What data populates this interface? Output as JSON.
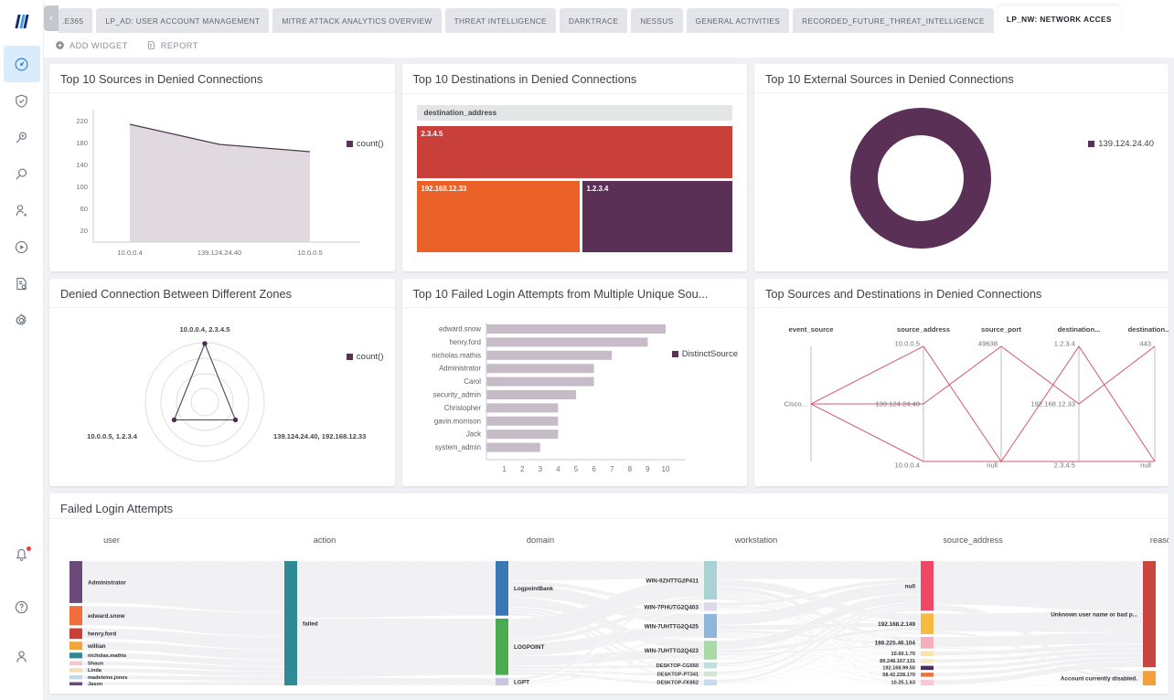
{
  "app": {
    "logo_name": "logpoint-logo"
  },
  "tabs": {
    "scroll_left_label": "‹",
    "items": [
      {
        "label": ".E365",
        "active": false,
        "clipped": true
      },
      {
        "label": "LP_AD: USER ACCOUNT MANAGEMENT",
        "active": false
      },
      {
        "label": "MITRE ATTACK ANALYTICS OVERVIEW",
        "active": false
      },
      {
        "label": "THREAT INTELLIGENCE",
        "active": false
      },
      {
        "label": "DARKTRACE",
        "active": false
      },
      {
        "label": "NESSUS",
        "active": false
      },
      {
        "label": "GENERAL ACTIVITIES",
        "active": false
      },
      {
        "label": "RECORDED_FUTURE_THREAT_INTELLIGENCE",
        "active": false
      },
      {
        "label": "LP_NW: NETWORK ACCES",
        "active": true
      }
    ]
  },
  "toolbar": {
    "add_widget_label": "ADD WIDGET",
    "report_label": "REPORT"
  },
  "sidebar": {
    "items": [
      {
        "name": "dashboard",
        "icon": "dashboard-icon",
        "active": true
      },
      {
        "name": "shield",
        "icon": "shield-check-icon",
        "active": false
      },
      {
        "name": "search-plus",
        "icon": "search-plus-icon",
        "active": false
      },
      {
        "name": "search",
        "icon": "search-icon",
        "active": false
      },
      {
        "name": "user-add",
        "icon": "user-add-icon",
        "active": false
      },
      {
        "name": "playbook",
        "icon": "play-circle-icon",
        "active": false
      },
      {
        "name": "report",
        "icon": "report-icon",
        "active": false
      },
      {
        "name": "settings",
        "icon": "gear-icon",
        "active": false
      }
    ],
    "bottom_items": [
      {
        "name": "notifications",
        "icon": "bell-icon",
        "badge": true
      },
      {
        "name": "help",
        "icon": "help-circle-icon",
        "badge": false
      },
      {
        "name": "profile",
        "icon": "user-icon",
        "badge": false
      }
    ]
  },
  "colors": {
    "accent_purple": "#5b3057",
    "area_fill": "#ded7de",
    "treemap_red": "#c9403a",
    "treemap_orange": "#ea6227",
    "treemap_purple": "#5b3057",
    "parallel_line": "#d4586e",
    "sankey_link": "#f2f2f3"
  },
  "widgets": [
    {
      "id": "w1",
      "title": "Top 10 Sources in Denied Connections"
    },
    {
      "id": "w2",
      "title": "Top 10 Destinations in Denied Connections"
    },
    {
      "id": "w3",
      "title": "Top 10 External Sources in Denied Connections"
    },
    {
      "id": "w4",
      "title": "Denied Connection Between Different Zones"
    },
    {
      "id": "w5",
      "title": "Top 10 Failed Login Attempts from Multiple Unique Sou..."
    },
    {
      "id": "w6",
      "title": "Top Sources and Destinations in Denied Connections"
    },
    {
      "id": "w7",
      "title": "Failed Login Attempts"
    }
  ],
  "chart_data": [
    {
      "type": "area",
      "widget": "w1",
      "title": "Top 10 Sources in Denied Connections",
      "categories": [
        "10.0.0.4",
        "139.124.24.40",
        "10.0.0.5"
      ],
      "values": [
        216,
        179,
        166
      ],
      "legend": [
        "count()"
      ],
      "legend_position": "top-right",
      "xlabel": "",
      "ylabel": "",
      "ylim": [
        0,
        240
      ],
      "yticks": [
        20,
        60,
        100,
        140,
        180,
        220
      ],
      "grid": false
    },
    {
      "type": "treemap",
      "widget": "w2",
      "title": "Top 10 Destinations in Denied Connections",
      "group_header": "destination_address",
      "items": [
        {
          "label": "2.3.4.5",
          "value": 45,
          "color": "#c9403a"
        },
        {
          "label": "192.168.12.33",
          "value": 29,
          "color": "#ea6227"
        },
        {
          "label": "1.2.3.4",
          "value": 26,
          "color": "#5b3057"
        }
      ]
    },
    {
      "type": "pie",
      "widget": "w3",
      "title": "Top 10 External Sources in Denied Connections",
      "donut": true,
      "labels": [
        "139.124.24.40"
      ],
      "values": [
        100
      ],
      "colors": [
        "#5b3057"
      ],
      "legend": [
        "139.124.24.40"
      ],
      "legend_position": "right"
    },
    {
      "type": "radar",
      "widget": "w4",
      "title": "Denied Connection Between Different Zones",
      "axes": [
        "10.0.0.4, 2.3.4.5",
        "139.124.24.40, 192.168.12.33",
        "10.0.0.5, 1.2.3.4"
      ],
      "values": [
        216,
        122,
        118
      ],
      "rings": 4,
      "legend": [
        "count()"
      ],
      "legend_position": "top-right"
    },
    {
      "type": "bar",
      "widget": "w5",
      "orientation": "horizontal",
      "title": "Top 10 Failed Login Attempts from Multiple Unique Sou...",
      "categories": [
        "edward.snow",
        "henry.ford",
        "nicholas.mathis",
        "Administrator",
        "Carol",
        "security_admin",
        "Christopher",
        "gavin.morrison",
        "Jack",
        "system_admin"
      ],
      "values": [
        10,
        9,
        7,
        6,
        6,
        5,
        4,
        4,
        4,
        3
      ],
      "legend": [
        "DistinctSource"
      ],
      "legend_position": "top-right",
      "xticks": [
        1,
        2,
        3,
        4,
        5,
        6,
        7,
        8,
        9,
        10
      ],
      "xlim": [
        0,
        10
      ],
      "bar_color": "#c5bcc8"
    },
    {
      "type": "parallel",
      "widget": "w6",
      "title": "Top Sources and Destinations in Denied Connections",
      "axes": [
        {
          "name": "event_source",
          "ticks": [
            {
              "label": "Cisco...",
              "pos": 0.5
            }
          ]
        },
        {
          "name": "source_address",
          "ticks": [
            {
              "label": "10.0.0.5",
              "pos": 0.0
            },
            {
              "label": "139.124.24.40",
              "pos": 0.5
            },
            {
              "label": "10.0.0.4",
              "pos": 1.0
            }
          ]
        },
        {
          "name": "source_port",
          "ticks": [
            {
              "label": "49638",
              "pos": 0.0
            },
            {
              "label": "null",
              "pos": 1.0
            }
          ]
        },
        {
          "name": "destination...",
          "ticks": [
            {
              "label": "1.2.3.4",
              "pos": 0.0
            },
            {
              "label": "192.168.12.33",
              "pos": 0.5
            },
            {
              "label": "2.3.4.5",
              "pos": 1.0
            }
          ]
        },
        {
          "name": "destination...",
          "ticks": [
            {
              "label": "443",
              "pos": 0.0
            },
            {
              "label": "null",
              "pos": 1.0
            }
          ]
        }
      ],
      "lines": [
        [
          0.5,
          0.0,
          1.0,
          0.0,
          1.0
        ],
        [
          0.5,
          0.5,
          0.0,
          0.5,
          0.0
        ],
        [
          0.5,
          1.0,
          1.0,
          1.0,
          1.0
        ]
      ],
      "line_color": "#d4586e"
    },
    {
      "type": "sankey",
      "widget": "w7",
      "title": "Failed Login Attempts",
      "columns": [
        "user",
        "action",
        "domain",
        "workstation",
        "source_address",
        "reason"
      ],
      "nodes": {
        "user": [
          {
            "label": "Administrator",
            "value": 52,
            "color": "#6b4a79"
          },
          {
            "label": "edward.snow",
            "value": 24,
            "color": "#ee6f3a"
          },
          {
            "label": "henry.ford",
            "value": 13,
            "color": "#c9403a"
          },
          {
            "label": "willian",
            "value": 10,
            "color": "#f1a73b"
          },
          {
            "label": "nicholas.mathis",
            "value": 7,
            "color": "#2e8b96"
          },
          {
            "label": "Shaun",
            "value": 5,
            "color": "#f3c6cc"
          },
          {
            "label": "Linda",
            "value": 5,
            "color": "#f5ddb8"
          },
          {
            "label": "madeleine.jones",
            "value": 5,
            "color": "#bcd9e8"
          },
          {
            "label": "Jason",
            "value": 4,
            "color": "#6b4a79"
          }
        ],
        "action": [
          {
            "label": "failed",
            "value": 125,
            "color": "#2e8b96"
          }
        ],
        "domain": [
          {
            "label": "LogpointBank",
            "value": 58,
            "color": "#3a77b5"
          },
          {
            "label": "LOGPOINT",
            "value": 60,
            "color": "#4aab4f"
          },
          {
            "label": "LGPT",
            "value": 8,
            "color": "#c9c6dd"
          }
        ],
        "workstation": [
          {
            "label": "WIN-9ZHTTG2P411",
            "value": 45,
            "color": "#a8d2d4"
          },
          {
            "label": "WIN-7PHUTG2Q403",
            "value": 10,
            "color": "#ddd9e8"
          },
          {
            "label": "WIN-7UHTTG2Q425",
            "value": 28,
            "color": "#8eb6d9"
          },
          {
            "label": "WIN-7UHTTG2Q423",
            "value": 22,
            "color": "#a8dba8"
          },
          {
            "label": "DESKTOP-CG550",
            "value": 7,
            "color": "#bfe0da"
          },
          {
            "label": "DESKTOP-PT341",
            "value": 6,
            "color": "#cfe8cf"
          },
          {
            "label": "DESKTOP-FK852",
            "value": 7,
            "color": "#c3dced"
          }
        ],
        "source_address": [
          {
            "label": "null",
            "value": 60,
            "color": "#ee4866"
          },
          {
            "label": "192.168.2.149",
            "value": 25,
            "color": "#f8b940"
          },
          {
            "label": "188.225.46.104",
            "value": 14,
            "color": "#f5aebb"
          },
          {
            "label": "10.60.1.70",
            "value": 6,
            "color": "#fbe4a8"
          },
          {
            "label": "89.248.167.131",
            "value": 5,
            "color": "#fbe9ba"
          },
          {
            "label": "192.168.99.50",
            "value": 5,
            "color": "#4a2c63"
          },
          {
            "label": "58.42.228.170",
            "value": 5,
            "color": "#e8743f"
          },
          {
            "label": "10.25.1.63",
            "value": 7,
            "color": "#f9c8d4"
          }
        ],
        "reason": [
          {
            "label": "Unknown user name or bad p...",
            "value": 110,
            "color": "#c9453f"
          },
          {
            "label": "Account currently disabled.",
            "value": 15,
            "color": "#f2a03c"
          }
        ]
      }
    }
  ]
}
